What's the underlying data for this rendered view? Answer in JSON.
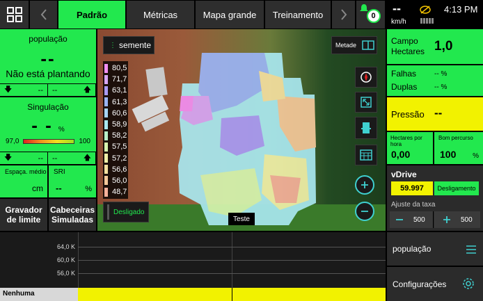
{
  "topbar": {
    "tabs": [
      {
        "label": "Padrão",
        "active": true
      },
      {
        "label": "Métricas",
        "active": false
      },
      {
        "label": "Mapa grande",
        "active": false
      },
      {
        "label": "Treinamento",
        "active": false
      }
    ],
    "alert_count": "0",
    "speed": "--",
    "speed_unit": "km/h",
    "time": "4:13 PM"
  },
  "left": {
    "populacao": {
      "title": "população",
      "value": "--",
      "status": "Não está plantando",
      "left": "--",
      "right": "--"
    },
    "singulacao": {
      "title": "Singulação",
      "value": "- -",
      "unit": "%",
      "min": "97,0",
      "max": "100",
      "left": "--",
      "right": "--"
    },
    "espaco": {
      "title": "Espaça. médio",
      "value": "",
      "unit": "cm"
    },
    "sri": {
      "title": "SRI",
      "value": "--",
      "unit": "%"
    },
    "gravador": "Gravador de limite",
    "cabeceiras": "Cabeceiras Simuladas"
  },
  "map": {
    "layer_label": "semente",
    "half_label": "Metade",
    "legend": [
      {
        "value": "80,5",
        "color": "#f28ff2"
      },
      {
        "value": "71,7",
        "color": "#d7a6f5"
      },
      {
        "value": "63,1",
        "color": "#aa9af5"
      },
      {
        "value": "61,3",
        "color": "#9bb4f5"
      },
      {
        "value": "60,6",
        "color": "#a7d4f5"
      },
      {
        "value": "58,9",
        "color": "#a9e8f0"
      },
      {
        "value": "58,2",
        "color": "#b8f0c8"
      },
      {
        "value": "57,5",
        "color": "#d7f5b0"
      },
      {
        "value": "57,2",
        "color": "#f0f0a8"
      },
      {
        "value": "56,6",
        "color": "#f5e0a0"
      },
      {
        "value": "56,0",
        "color": "#f5c89a"
      },
      {
        "value": "48,7",
        "color": "#f5b09a"
      }
    ],
    "toggle_label": "Desligado",
    "test_label": "Teste"
  },
  "right": {
    "campo": {
      "label": "Campo Hectares",
      "value": "1,0"
    },
    "falhas": {
      "label": "Falhas",
      "value": "-- %"
    },
    "duplas": {
      "label": "Duplas",
      "value": "-- %"
    },
    "pressao": {
      "label": "Pressão",
      "value": "--"
    },
    "hectares_hora": {
      "label": "Hectares por hora",
      "value": "0,00"
    },
    "bom_percurso": {
      "label": "Bom percurso",
      "value": "100",
      "unit": "%"
    },
    "vdrive": {
      "title": "vDrive",
      "value": "59.997",
      "state": "Desligamento",
      "adjust_label": "Ajuste da taxa",
      "minus_value": "500",
      "plus_value": "500"
    },
    "populacao_menu": "população",
    "config_label": "Configurações"
  },
  "chart": {
    "y_ticks": [
      "64,0 K",
      "60,0 K",
      "56,0 K"
    ],
    "bottom_label": "Nenhuma"
  }
}
